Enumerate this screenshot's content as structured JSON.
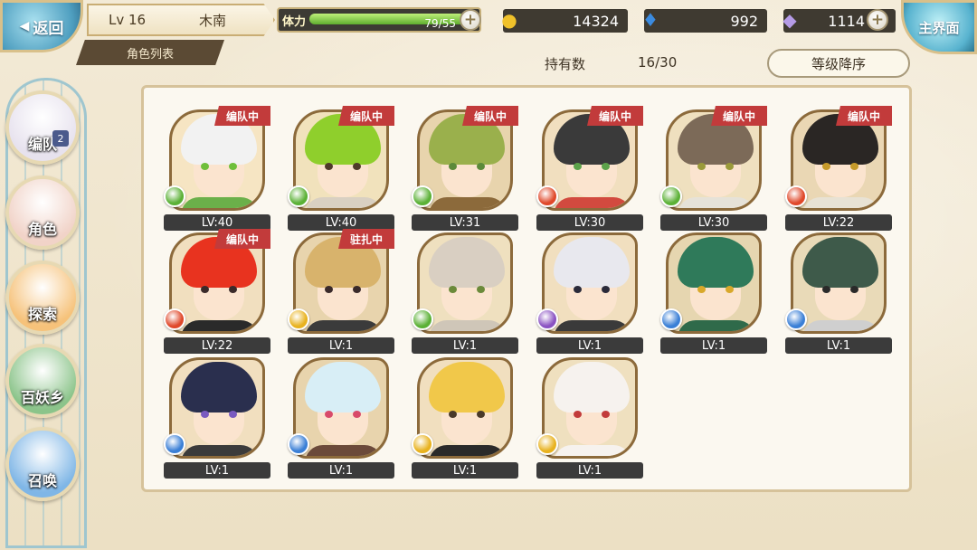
{
  "nav": {
    "back_label": "返回",
    "main_label": "主界面"
  },
  "player": {
    "level": "Lv 16",
    "name": "木南",
    "tab_label": "角色列表"
  },
  "stamina": {
    "label": "体力",
    "value": "79/55",
    "fill": 1.0,
    "plus": "+"
  },
  "currencies": [
    {
      "icon": "gold-coin-icon",
      "glyph": "●",
      "color": "#f0c12a",
      "value": "14324"
    },
    {
      "icon": "blue-flame-icon",
      "glyph": "♦",
      "color": "#3b8be0",
      "value": "992"
    },
    {
      "icon": "crystal-icon",
      "glyph": "◆",
      "color": "#b59be6",
      "value": "1114",
      "plus": "+"
    }
  ],
  "holding": {
    "label": "持有数",
    "value": "16/30"
  },
  "sort": {
    "label": "等级降序"
  },
  "sidebar": [
    {
      "name": "team",
      "label": "编队",
      "badge": "2",
      "color": "#e7e2ee"
    },
    {
      "name": "character",
      "label": "角色",
      "color": "#f1d3c8"
    },
    {
      "name": "explore",
      "label": "探索",
      "color": "#f6c27a"
    },
    {
      "name": "yokai-village",
      "label": "百妖乡",
      "color": "#8bc48a"
    },
    {
      "name": "summon",
      "label": "召唤",
      "color": "#7fb6e6"
    }
  ],
  "characters": [
    {
      "level": "LV:40",
      "status": "编队中",
      "element": "wind",
      "hair": "#f2f2f2",
      "eye": "#6fbf3a",
      "body": "#6bb04a",
      "bg": "#f6e5c3"
    },
    {
      "level": "LV:40",
      "status": "编队中",
      "element": "wind",
      "hair": "#8fcf2c",
      "eye": "#4f3a2a",
      "body": "#d9d0c2",
      "bg": "#f1e2bc"
    },
    {
      "level": "LV:31",
      "status": "编队中",
      "element": "wind",
      "hair": "#9ab04c",
      "eye": "#5c8a3a",
      "body": "#8c6a3b",
      "bg": "#e8d4ad"
    },
    {
      "level": "LV:30",
      "status": "编队中",
      "element": "fire",
      "hair": "#3a3a3a",
      "eye": "#5ca24a",
      "body": "#d24a3f",
      "bg": "#f1dfbf"
    },
    {
      "level": "LV:30",
      "status": "编队中",
      "element": "wind",
      "hair": "#7c6a58",
      "eye": "#9a9a3a",
      "body": "#e6e2d8",
      "bg": "#efe0bf"
    },
    {
      "level": "LV:22",
      "status": "编队中",
      "element": "fire",
      "hair": "#2a2624",
      "eye": "#c69a2a",
      "body": "#e8e2d4",
      "bg": "#ead7b4"
    },
    {
      "level": "LV:22",
      "status": "编队中",
      "element": "fire",
      "hair": "#e8331f",
      "eye": "#3a2a2a",
      "body": "#2a2a2a",
      "bg": "#f1dfbf"
    },
    {
      "level": "LV:1",
      "status": "驻扎中",
      "element": "light",
      "hair": "#d8b36c",
      "eye": "#3a2a2a",
      "body": "#3b3b3b",
      "bg": "#e8d4ad"
    },
    {
      "level": "LV:1",
      "status": "",
      "element": "wind",
      "hair": "#d9cfc2",
      "eye": "#6b8a3a",
      "body": "#cfc6b8",
      "bg": "#efe0bf"
    },
    {
      "level": "LV:1",
      "status": "",
      "element": "dark",
      "hair": "#e8e8ee",
      "eye": "#2a2a3a",
      "body": "#3a3a3a",
      "bg": "#f1dfbf"
    },
    {
      "level": "LV:1",
      "status": "",
      "element": "water",
      "hair": "#2f7a5a",
      "eye": "#d8a82a",
      "body": "#2f6a4a",
      "bg": "#e6d6b0"
    },
    {
      "level": "LV:1",
      "status": "",
      "element": "water",
      "hair": "#3e5a4a",
      "eye": "#2a2a2a",
      "body": "#cfcfcf",
      "bg": "#e9dab8"
    },
    {
      "level": "LV:1",
      "status": "",
      "element": "water",
      "hair": "#2a2f4e",
      "eye": "#7a5ac0",
      "body": "#3b3b3b",
      "bg": "#f1dfbf"
    },
    {
      "level": "LV:1",
      "status": "",
      "element": "water",
      "hair": "#d8eef6",
      "eye": "#d84a6a",
      "body": "#6b4a3a",
      "bg": "#e8d4ad"
    },
    {
      "level": "LV:1",
      "status": "",
      "element": "light",
      "hair": "#f1c84a",
      "eye": "#4a3a2a",
      "body": "#2a2a2a",
      "bg": "#f1dfbf"
    },
    {
      "level": "LV:1",
      "status": "",
      "element": "light",
      "hair": "#f6f2ee",
      "eye": "#c23b3b",
      "body": "#f6f2ee",
      "bg": "#efe0bf"
    }
  ],
  "element_colors": {
    "wind": "#5bb136",
    "fire": "#e0482a",
    "light": "#e8b21f",
    "dark": "#8a52c2",
    "water": "#3a7fd6"
  }
}
